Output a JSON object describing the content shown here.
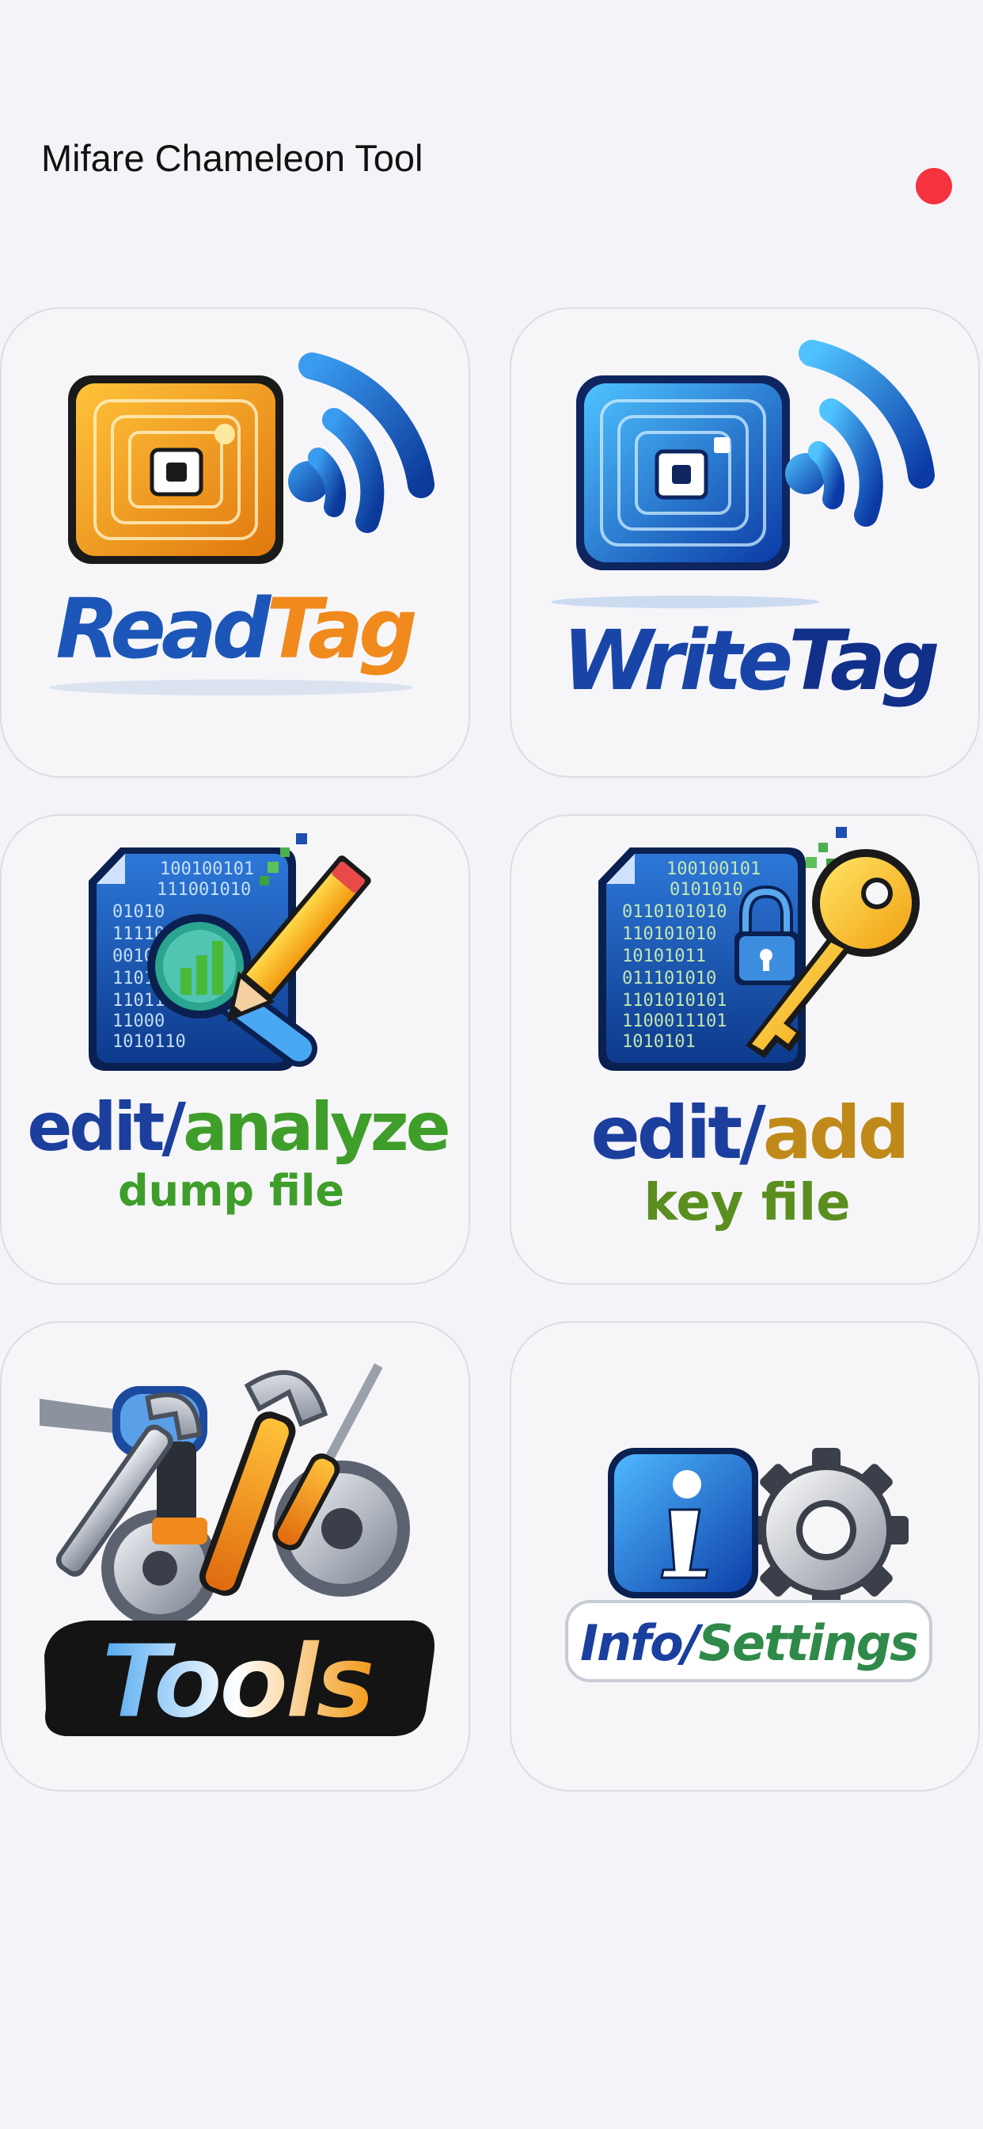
{
  "header": {
    "title": "Mifare Chameleon Tool",
    "status_color": "#f5333f"
  },
  "tiles": [
    {
      "id": "read-tag",
      "word1": "Read",
      "word2": "Tag",
      "icon": "rfid-chip-orange-with-signal-waves"
    },
    {
      "id": "write-tag",
      "word1": "Write",
      "word2": "Tag",
      "icon": "rfid-chip-blue-with-signal-waves"
    },
    {
      "id": "edit-analyze",
      "line1a": "edit/",
      "line1b": "analyze",
      "line2": "dump file",
      "icon": "binary-file-magnifier-pencil"
    },
    {
      "id": "edit-add-key",
      "line1a": "edit/",
      "line1b": "add",
      "line2": "key file",
      "icon": "binary-file-lock-key"
    },
    {
      "id": "tools",
      "label": "Tools",
      "icon": "drill-wrenches-gears"
    },
    {
      "id": "info-settings",
      "label_a": "Info/",
      "label_b": "Settings",
      "icon": "info-gear"
    }
  ],
  "binary": {
    "file1": [
      "100100101",
      "111001010",
      "01010",
      "11110",
      "00101",
      "1101",
      "11011",
      "11000",
      "1010110"
    ],
    "file2": [
      "100100101",
      "0101010",
      "0110101010",
      "110101010",
      "10101011",
      "011101010",
      "1101010101",
      "1100011101",
      "1010101"
    ]
  },
  "colors": {
    "blue": "#1c56b8",
    "orange": "#f08a1c",
    "green": "#3f9e2a",
    "background": "#f4f4f8"
  }
}
